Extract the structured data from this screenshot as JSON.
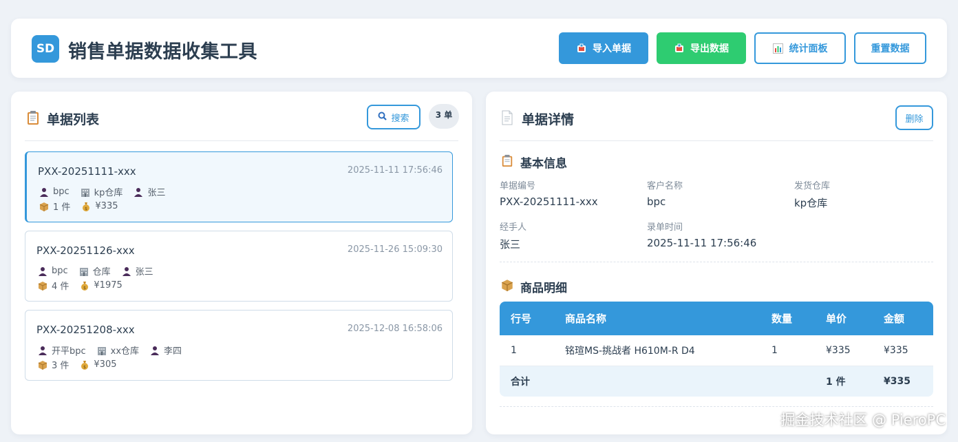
{
  "header": {
    "logo_text": "SD",
    "title": "销售单据数据收集工具",
    "buttons": {
      "import": "导入单据",
      "export": "导出数据",
      "stats": "统计面板",
      "reset": "重置数据"
    }
  },
  "list_panel": {
    "title": "单据列表",
    "search_label": "搜索",
    "count_badge": "3 单",
    "orders": [
      {
        "no": "PXX-20251111-xxx",
        "time": "2025-11-11 17:56:46",
        "customer": "bpc",
        "warehouse": "kp仓库",
        "handler": "张三",
        "qty": "1 件",
        "amount": "¥335"
      },
      {
        "no": "PXX-20251126-xxx",
        "time": "2025-11-26 15:09:30",
        "customer": "bpc",
        "warehouse": "仓库",
        "handler": "张三",
        "qty": "4 件",
        "amount": "¥1975"
      },
      {
        "no": "PXX-20251208-xxx",
        "time": "2025-12-08 16:58:06",
        "customer": "开平bpc",
        "warehouse": "xx仓库",
        "handler": "李四",
        "qty": "3 件",
        "amount": "¥305"
      }
    ]
  },
  "detail_panel": {
    "title": "单据详情",
    "delete_label": "删除",
    "basic_info": {
      "title": "基本信息",
      "fields": {
        "order_no_label": "单据编号",
        "order_no": "PXX-20251111-xxx",
        "customer_label": "客户名称",
        "customer": "bpc",
        "warehouse_label": "发货仓库",
        "warehouse": "kp仓库",
        "handler_label": "经手人",
        "handler": "张三",
        "time_label": "录单时间",
        "time": "2025-11-11 17:56:46"
      }
    },
    "items": {
      "title": "商品明细",
      "columns": [
        "行号",
        "商品名称",
        "数量",
        "单价",
        "金额"
      ],
      "rows": [
        [
          "1",
          "铭瑄MS-挑战者 H610M-R D4",
          "1",
          "¥335",
          "¥335"
        ]
      ],
      "total": {
        "label": "合计",
        "qty": "1 件",
        "amount": "¥335"
      }
    }
  },
  "watermark": "掘金技术社区 @ PieroPC",
  "colors": {
    "accent": "#3498db",
    "success": "#2ecc71",
    "text": "#2c3e50"
  }
}
